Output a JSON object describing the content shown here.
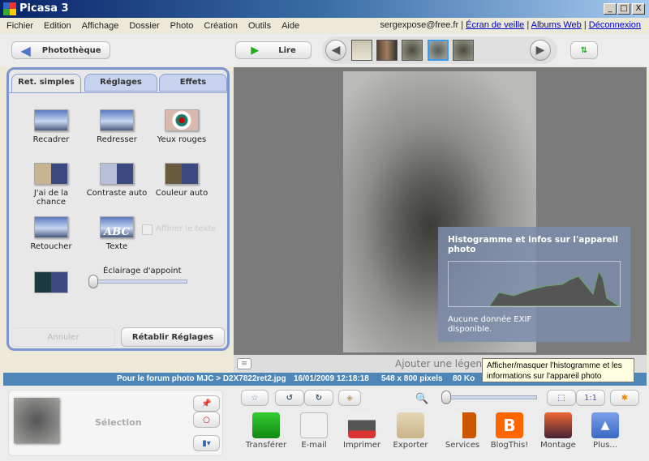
{
  "window": {
    "title": "Picasa 3",
    "controls": [
      "_",
      "□",
      "X"
    ]
  },
  "menu": [
    "Fichier",
    "Edition",
    "Affichage",
    "Dossier",
    "Photo",
    "Création",
    "Outils",
    "Aide"
  ],
  "account": {
    "email": "sergexpose@free.fr",
    "links": [
      "Écran de veille",
      "Albums Web",
      "Déconnexion"
    ],
    "separator": "|"
  },
  "toolbar": {
    "library": "Photothèque",
    "play": "Lire"
  },
  "left_panel": {
    "tabs": [
      "Ret. simples",
      "Réglages",
      "Effets"
    ],
    "tools": [
      "Recadrer",
      "Redresser",
      "Yeux rouges",
      "J'ai de la chance",
      "Contraste auto",
      "Couleur auto",
      "Retoucher",
      "Texte"
    ],
    "checkbox_label": "Affiner le texte",
    "fill_light_label": "Éclairage d'appoint",
    "fill_light_value": 0,
    "undo": "Annuler",
    "reset": "Rétablir Réglages"
  },
  "histogram": {
    "title": "Histogramme et infos sur l'appareil photo",
    "exif": "Aucune donnée EXIF disponible."
  },
  "caption_placeholder": "Ajouter une légende",
  "status": {
    "path": "Pour le forum photo MJC > D2X7822ret2.jpg",
    "date": "16/01/2009 12:18:18",
    "size": "548 x 800 pixels",
    "filesize": "80 Ko"
  },
  "tooltip": "Afficher/masquer l'histogramme et les informations sur l'appareil photo",
  "selection_label": "Sélection",
  "zoom_value": 0,
  "zoom_fit": "1:1",
  "actions": [
    "Transférer",
    "E-mail",
    "Imprimer",
    "Exporter",
    "Services",
    "BlogThis!",
    "Montage",
    "Plus..."
  ],
  "colors": {
    "accent": "#4e86b8",
    "panel_border": "#7c95d0"
  }
}
